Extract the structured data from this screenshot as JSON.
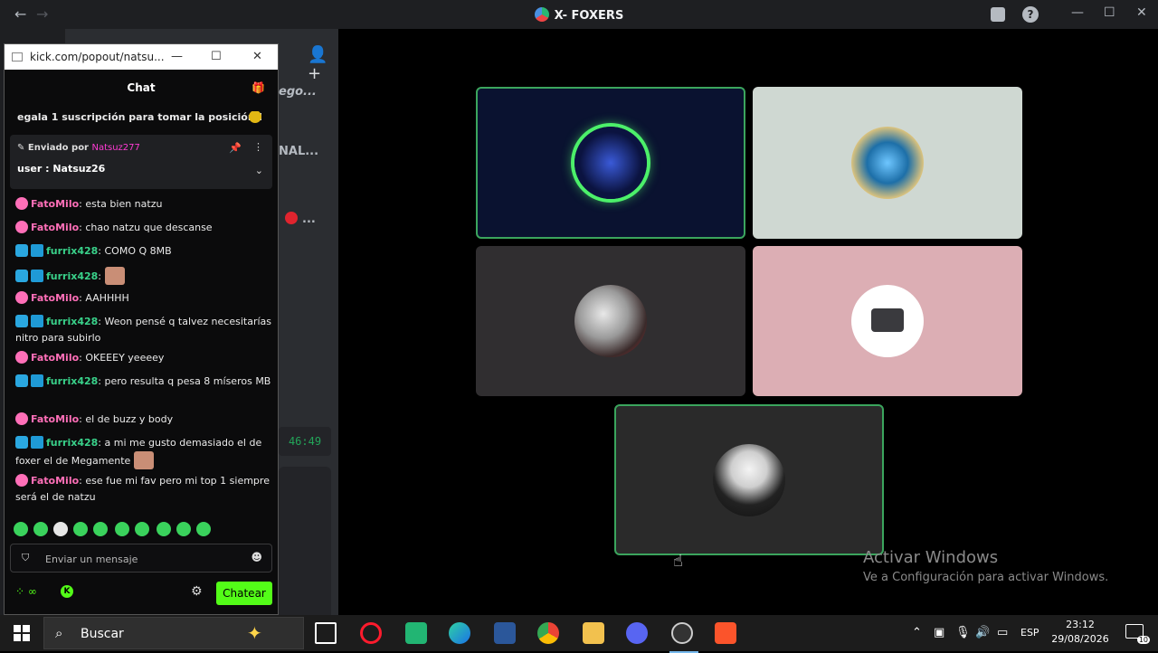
{
  "window": {
    "title": "X- FOXERS",
    "back": "←",
    "forward": "→",
    "minimize": "—",
    "maximize": "☐",
    "close": "✕"
  },
  "sidebar_bg": {
    "fragment_1": "ego...",
    "fragment_2": "NAL...",
    "fragment_3": "...",
    "timer": "46:49"
  },
  "popout": {
    "url": "kick.com/popout/natsu...",
    "minimize": "—",
    "maximize": "☐",
    "close": "✕",
    "chat_title": "Chat",
    "promo": "egala 1 suscripción para tomar la posición 1",
    "pinned": {
      "sent_by_label": "Enviado por",
      "sent_by_user": "Natsuz277",
      "message": "user : Natsuz26"
    },
    "messages": [
      {
        "user": "FatoMilo",
        "color": "pink",
        "badges": [
          "23"
        ],
        "text": ": esta bien natzu"
      },
      {
        "user": "FatoMilo",
        "color": "pink",
        "badges": [
          "23"
        ],
        "text": ": chao natzu que descanse"
      },
      {
        "user": "furrix428",
        "color": "green",
        "badges": [
          "30",
          "pick"
        ],
        "text": ": COMO Q 8MB"
      },
      {
        "user": "furrix428",
        "color": "green",
        "badges": [
          "30",
          "pick"
        ],
        "text": ":"
      },
      {
        "user": "FatoMilo",
        "color": "pink",
        "badges": [
          "23"
        ],
        "text": ": AAHHHH"
      },
      {
        "user": "furrix428",
        "color": "green",
        "badges": [
          "30",
          "pick"
        ],
        "text": ": Weon pensé q talvez necesitarías nitro para subirlo"
      },
      {
        "user": "FatoMilo",
        "color": "pink",
        "badges": [
          "23"
        ],
        "text": ": OKEEEY yeeeey"
      },
      {
        "user": "furrix428",
        "color": "green",
        "badges": [
          "30",
          "pick"
        ],
        "text": ": pero resulta q pesa 8 míseros MB"
      },
      {
        "user": "FatoMilo",
        "color": "pink",
        "badges": [
          "23"
        ],
        "text": ": el de buzz y body"
      },
      {
        "user": "furrix428",
        "color": "green",
        "badges": [
          "30",
          "pick"
        ],
        "text": ": a mi me gusto demasiado el de foxer el de Megamente"
      },
      {
        "user": "FatoMilo",
        "color": "pink",
        "badges": [
          "23"
        ],
        "text": ": ese fue mi fav pero mi top 1 siempre será el de natzu"
      }
    ],
    "composer_placeholder": "Enviar un mensaje",
    "send_button": "Chatear",
    "infinity": "∞"
  },
  "watermark": {
    "heading": "Activar Windows",
    "sub": "Ve a Configuración para activar Windows."
  },
  "taskbar": {
    "search_label": "Buscar",
    "language": "ESP",
    "time": "23:12",
    "date": "29/08/2026",
    "notifications": "10"
  },
  "colors": {
    "speaking_border": "#3ba55d",
    "kick_green": "#53fc18",
    "pink_user": "#ff6fb8",
    "green_user": "#39d18a"
  }
}
